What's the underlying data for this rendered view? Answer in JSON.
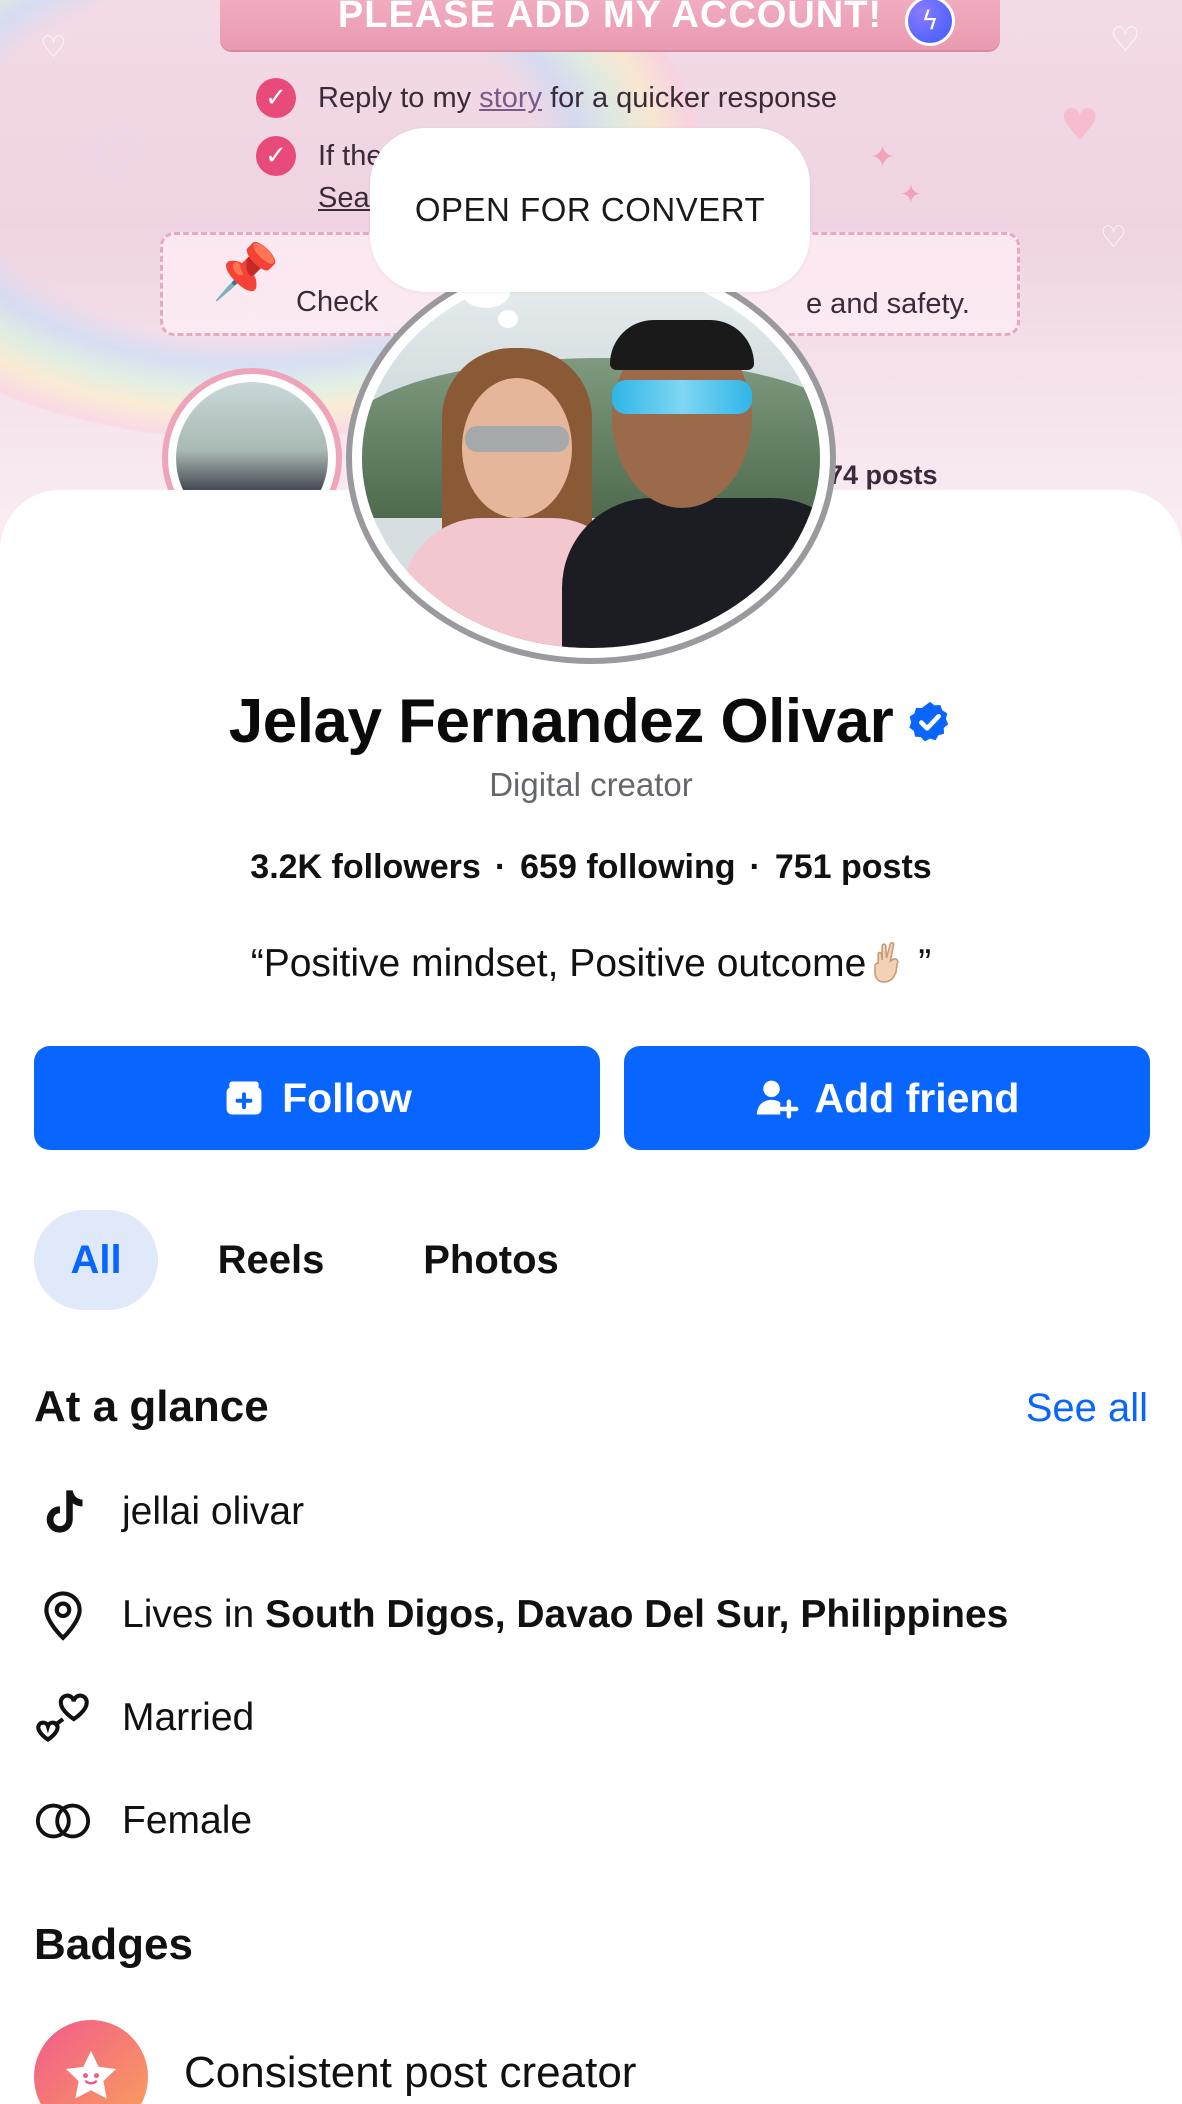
{
  "cover": {
    "ribbon_text": "PLEASE ADD MY ACCOUNT!",
    "line1_prefix": "Reply to my",
    "line1_link": "story",
    "line1_suffix": "for a quicker response",
    "line2_partial": "If the",
    "line3_partial": "Sear",
    "note_left": "Check",
    "note_right": "e and safety.",
    "posts_partial": "74 posts"
  },
  "profile": {
    "note_bubble": "OPEN FOR CONVERT",
    "name": "Jelay Fernandez Olivar",
    "category": "Digital creator",
    "followers": "3.2K followers",
    "following": "659 following",
    "posts": "751 posts",
    "stats_separator": "·",
    "bio_open": "“Positive mindset, Positive outcome",
    "bio_close": "”",
    "verified_icon": "verified-badge-icon",
    "accent_color": "#0866ff"
  },
  "actions": {
    "follow_label": "Follow",
    "add_friend_label": "Add friend"
  },
  "tabs": [
    {
      "label": "All",
      "active": true
    },
    {
      "label": "Reels",
      "active": false
    },
    {
      "label": "Photos",
      "active": false
    }
  ],
  "glance": {
    "title": "At a glance",
    "see_all": "See all",
    "tiktok": "jellai olivar",
    "lives_prefix": "Lives in",
    "lives_place": "South Digos, Davao Del Sur, Philippines",
    "relationship": "Married",
    "gender": "Female"
  },
  "badges": {
    "title": "Badges",
    "items": [
      {
        "label": "Consistent post creator",
        "icon": "star-face-icon"
      }
    ]
  }
}
